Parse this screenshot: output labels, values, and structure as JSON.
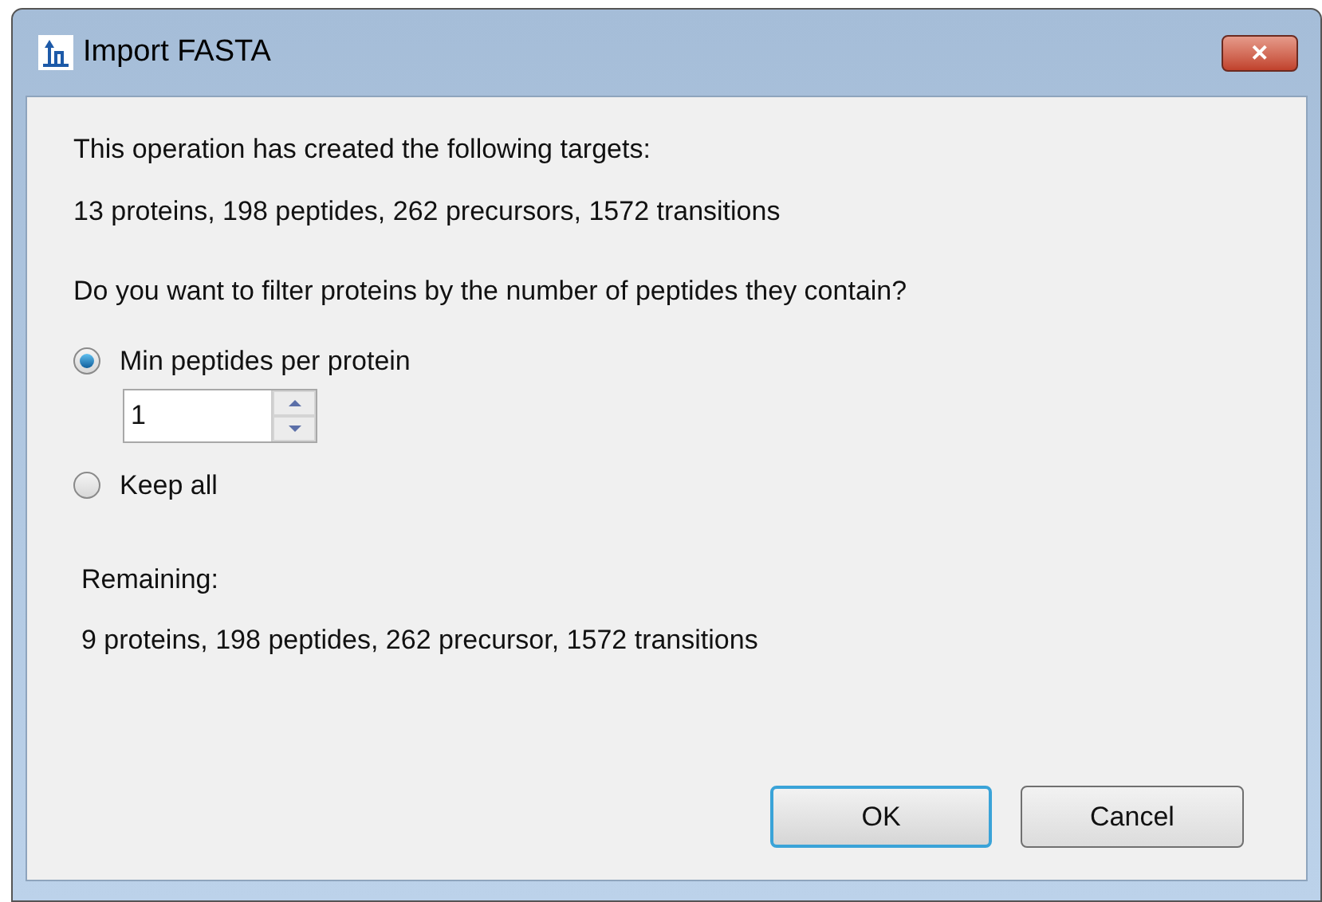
{
  "window": {
    "title": "Import FASTA",
    "close_button": "✕"
  },
  "intro": "This operation has created the following targets:",
  "created": "13 proteins, 198 peptides, 262 precursors, 1572 transitions",
  "question": "Do you want to filter proteins by the number of peptides they contain?",
  "options": [
    {
      "kind": "spin",
      "label": "Min peptides per protein",
      "selected": true,
      "value": "1"
    },
    {
      "kind": "plain",
      "label": "Keep all",
      "selected": false
    }
  ],
  "remaining_label": "Remaining:",
  "remaining": "9 proteins, 198 peptides, 262 precursor, 1572 transitions",
  "buttons": [
    {
      "label": "OK",
      "default": true
    },
    {
      "label": "Cancel",
      "default": false
    }
  ]
}
